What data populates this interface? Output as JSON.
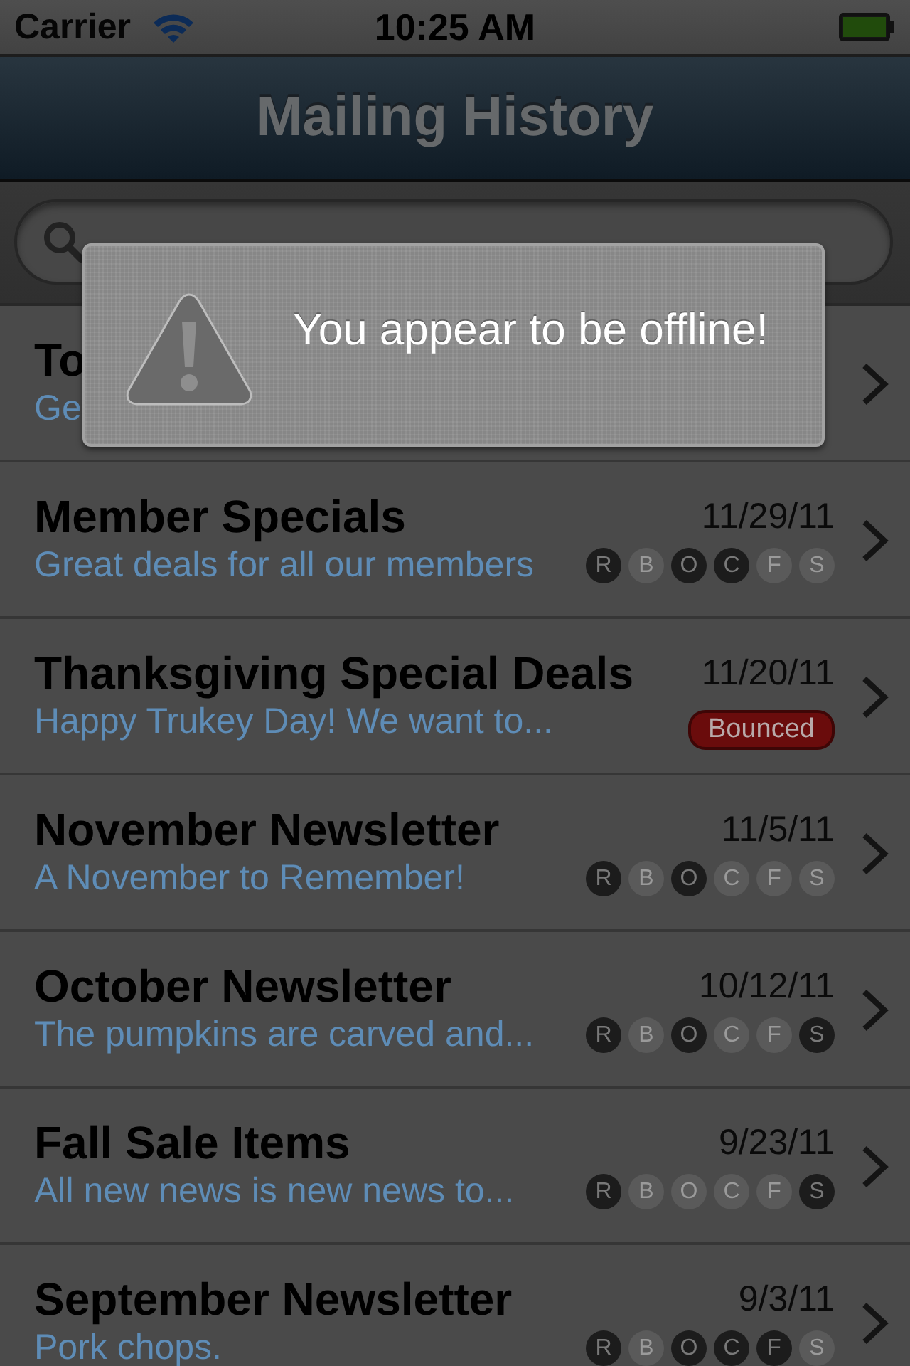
{
  "status_bar": {
    "carrier": "Carrier",
    "time": "10:25 AM"
  },
  "nav": {
    "title": "Mailing History"
  },
  "rows": [
    {
      "kind": "plain",
      "title": "To",
      "subtitle": "Ge"
    },
    {
      "kind": "flags",
      "title": "Member Specials",
      "subtitle": "Great deals for all our members",
      "date": "11/29/11",
      "badges": [
        {
          "letter": "R",
          "on": true
        },
        {
          "letter": "B",
          "on": false
        },
        {
          "letter": "O",
          "on": true
        },
        {
          "letter": "C",
          "on": true
        },
        {
          "letter": "F",
          "on": false
        },
        {
          "letter": "S",
          "on": false
        }
      ]
    },
    {
      "kind": "status",
      "title": "Thanksgiving Special Deals",
      "subtitle": "Happy Trukey Day! We want to...",
      "date": "11/20/11",
      "status": "Bounced"
    },
    {
      "kind": "flags",
      "title": "November Newsletter",
      "subtitle": "A November to Remember!",
      "date": "11/5/11",
      "badges": [
        {
          "letter": "R",
          "on": true
        },
        {
          "letter": "B",
          "on": false
        },
        {
          "letter": "O",
          "on": true
        },
        {
          "letter": "C",
          "on": false
        },
        {
          "letter": "F",
          "on": false
        },
        {
          "letter": "S",
          "on": false
        }
      ]
    },
    {
      "kind": "flags",
      "title": "October Newsletter",
      "subtitle": "The pumpkins are carved and...",
      "date": "10/12/11",
      "badges": [
        {
          "letter": "R",
          "on": true
        },
        {
          "letter": "B",
          "on": false
        },
        {
          "letter": "O",
          "on": true
        },
        {
          "letter": "C",
          "on": false
        },
        {
          "letter": "F",
          "on": false
        },
        {
          "letter": "S",
          "on": true
        }
      ]
    },
    {
      "kind": "flags",
      "title": "Fall Sale Items",
      "subtitle": "All new news is new news to...",
      "date": "9/23/11",
      "badges": [
        {
          "letter": "R",
          "on": true
        },
        {
          "letter": "B",
          "on": false
        },
        {
          "letter": "O",
          "on": false
        },
        {
          "letter": "C",
          "on": false
        },
        {
          "letter": "F",
          "on": false
        },
        {
          "letter": "S",
          "on": true
        }
      ]
    },
    {
      "kind": "flags",
      "title": "September Newsletter",
      "subtitle": "Pork chops.",
      "date": "9/3/11",
      "badges": [
        {
          "letter": "R",
          "on": true
        },
        {
          "letter": "B",
          "on": false
        },
        {
          "letter": "O",
          "on": true
        },
        {
          "letter": "C",
          "on": true
        },
        {
          "letter": "F",
          "on": true
        },
        {
          "letter": "S",
          "on": false
        }
      ]
    }
  ],
  "alert": {
    "message": "You appear to be offline!"
  }
}
